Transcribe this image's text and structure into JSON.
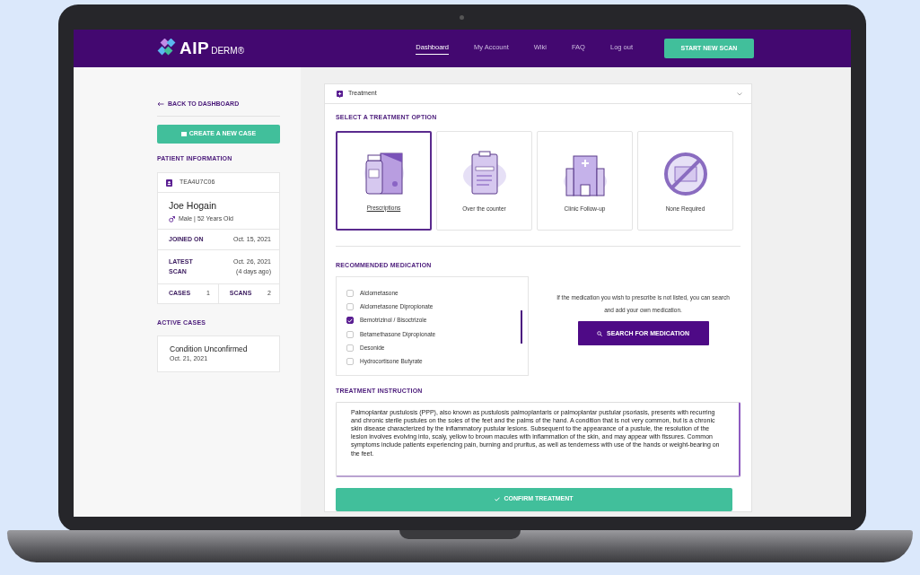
{
  "navbar": {
    "logo": {
      "brand": "AIP",
      "product": "DERM",
      "mark": "®"
    },
    "links": [
      {
        "label": "Dashboard",
        "selected": true
      },
      {
        "label": "My Account",
        "selected": false
      },
      {
        "label": "Wiki",
        "selected": false
      },
      {
        "label": "FAQ",
        "selected": false
      },
      {
        "label": "Log out",
        "selected": false
      }
    ],
    "action_button": "START NEW SCAN"
  },
  "sidebar": {
    "back_link": "BACK TO DASHBOARD",
    "create_button": "CREATE A NEW CASE",
    "patient_heading": "PATIENT INFORMATION",
    "patient": {
      "id": "TEA4U7C06",
      "name": "Joe Hogain",
      "details": "Male | 52 Years Old",
      "rows": [
        {
          "label": "JOINED ON",
          "values": [
            "Oct. 15, 2021"
          ]
        },
        {
          "label": "LATEST SCAN",
          "values": [
            "Oct. 26, 2021",
            "(4 days ago)"
          ]
        }
      ],
      "counts": [
        {
          "label": "CASES",
          "value": "1"
        },
        {
          "label": "SCANS",
          "value": "2"
        }
      ]
    },
    "active_heading": "ACTIVE CASES",
    "active_cases": [
      {
        "title": "Condition Unconfirmed",
        "date": "Oct. 21, 2021"
      }
    ]
  },
  "treatment": {
    "title": "Treatment",
    "expanded": true,
    "option_heading": "SELECT A TREATMENT OPTION",
    "options": [
      {
        "label": "Prescriptions",
        "kind": "prescription",
        "selected": true
      },
      {
        "label": "Over the counter",
        "kind": "clipboard",
        "selected": false
      },
      {
        "label": "Clinic Follow-up",
        "kind": "clinic",
        "selected": false
      },
      {
        "label": "None Required",
        "kind": "none",
        "selected": false
      }
    ],
    "medication_heading": "RECOMMENDED MEDICATION",
    "medications": [
      {
        "name": "Alclometasone",
        "checked": false
      },
      {
        "name": "Alclometasone Dipropionate",
        "checked": false
      },
      {
        "name": "Bemotrizinol / Bisoctrizole",
        "checked": true
      },
      {
        "name": "Betamethasone Dipropionate",
        "checked": false
      },
      {
        "name": "Desonide",
        "checked": false
      },
      {
        "name": "Hydrocortisone Butyrate",
        "checked": false
      }
    ],
    "search_hint": "If the medication you wish to prescribe is not listed, you can search and add your own medication.",
    "search_button": "SEARCH FOR MEDICATION",
    "instruction_heading": "TREATMENT INSTRUCTION",
    "instruction": "Palmoplantar pustulosis (PPP), also known as pustulosis palmoplantaris or palmoplantar pustular psoriasis, presents with recurring and chronic sterile pustules on the soles of the feet and the palms of the hand. A condition that is not very common, but is a chronic skin disease characterized by the inflammatory pustular lesions. Subsequent to the appearance of a pustule, the resolution of the lesion involves evolving into, scaly, yellow to brown macules with inflammation of the skin, and may appear with fissures. Common symptoms include patients experiencing pain, burning and pruritus, as well as tenderness with use of the hands or weight-bearing on the feet.",
    "confirm_button": "CONFIRM TREATMENT"
  }
}
